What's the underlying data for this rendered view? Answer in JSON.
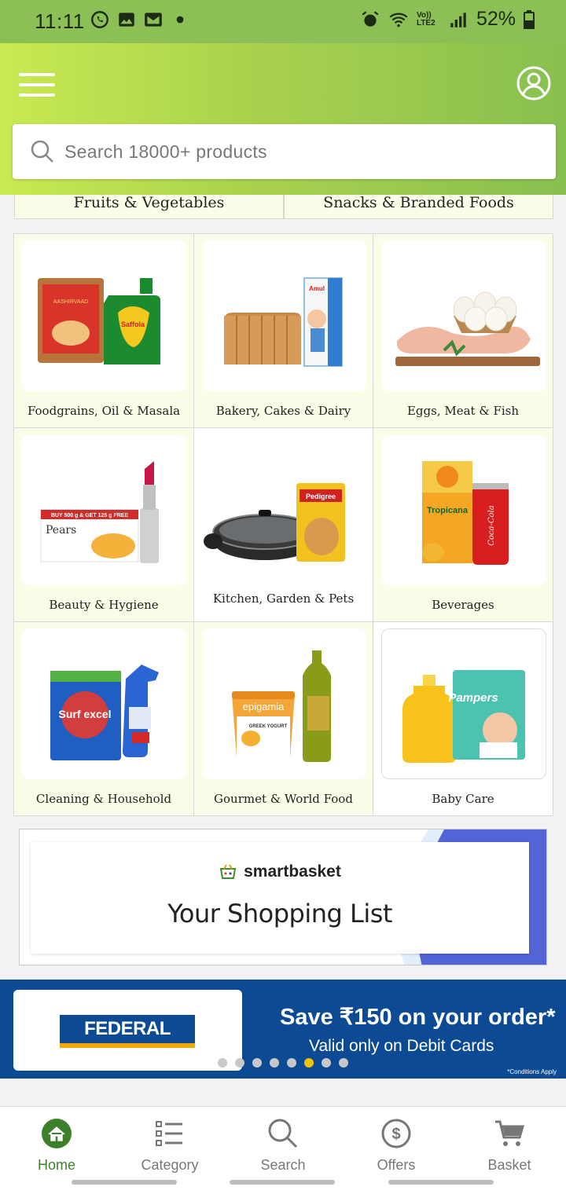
{
  "status_bar": {
    "time": "11:11",
    "network": "Vo)) LTE2",
    "battery": "52%"
  },
  "header": {
    "search_placeholder": "Search 18000+ products"
  },
  "category_tabs": [
    {
      "label": "Fruits & Vegetables"
    },
    {
      "label": "Snacks & Branded Foods"
    }
  ],
  "categories": [
    {
      "label": "Foodgrains, Oil & Masala"
    },
    {
      "label": "Bakery, Cakes & Dairy"
    },
    {
      "label": "Eggs, Meat & Fish"
    },
    {
      "label": "Beauty & Hygiene"
    },
    {
      "label": "Kitchen, Garden & Pets"
    },
    {
      "label": "Beverages"
    },
    {
      "label": "Cleaning & Household"
    },
    {
      "label": "Gourmet & World Food"
    },
    {
      "label": "Baby Care"
    }
  ],
  "product_image_text": {
    "pears": "Pears",
    "pears_offer": "BUY 500 g & GET 125 g FREE",
    "pedigree": "Pedigree",
    "tropicana": "Tropicana",
    "cocacola": "Coca-Cola",
    "surf": "Surf excel",
    "epigamia": "epigamia",
    "greek": "GREEK YOGURT",
    "pampers": "Pampers",
    "saffola": "Saffola",
    "aashirvaad": "AASHIRVAAD",
    "amul": "Amul"
  },
  "shopping_banner": {
    "brand": "smartbasket",
    "title": "Your Shopping List"
  },
  "bank_banner": {
    "bank_name": "FEDERAL BANK",
    "offer": "Save ₹150 on your order*",
    "subtext": "Valid only on Debit Cards",
    "fine_print": "*Conditions Apply",
    "slide_count": 8,
    "active_slide": 6
  },
  "bottom_nav": [
    {
      "label": "Home",
      "icon": "home-icon",
      "active": true
    },
    {
      "label": "Category",
      "icon": "list-icon",
      "active": false
    },
    {
      "label": "Search",
      "icon": "search-icon",
      "active": false
    },
    {
      "label": "Offers",
      "icon": "offers-icon",
      "active": false
    },
    {
      "label": "Basket",
      "icon": "cart-icon",
      "active": false
    }
  ],
  "colors": {
    "brand_green": "#8cbf55",
    "active_nav": "#3d7f2a",
    "bank_blue": "#0c4b94",
    "tile_bg": "#fbfde9"
  }
}
